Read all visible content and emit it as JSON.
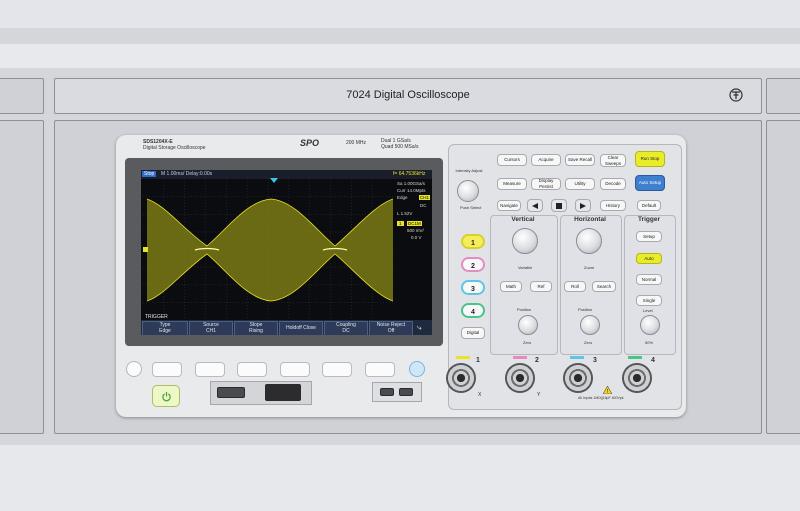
{
  "rack": {
    "title": "7024 Digital Oscilloscope"
  },
  "scope": {
    "model": "SDS1204X-E",
    "model_sub": "Digital Storage Oscilloscope",
    "brand": "SPO",
    "bandwidth": "200 MHz",
    "spec_dual": "Dual   1 GSa/s",
    "spec_quad": "Quad   500 MSa/s"
  },
  "screen": {
    "run_state": "Stop",
    "timebase": "M 1.00ms/  Delay:0.00s",
    "freq": "f= 64.7536kHz",
    "sample_rate": "Sa 1.00GSa/s",
    "memory": "Curr 14.0Mpts",
    "trig_edge": "Edge",
    "trig_ch": "CH1",
    "trig_dc": "DC",
    "trig_level": "L   1.52V",
    "ch1_label": "1",
    "ch1_coupling": "DC1M",
    "ch1_scale": "500 mV/",
    "ch1_offset": "0.0 V",
    "menu_title": "TRIGGER",
    "menu": [
      {
        "top": "Type",
        "bottom": "Edge"
      },
      {
        "top": "Source",
        "bottom": "CH1"
      },
      {
        "top": "Slope",
        "bottom": "Rising"
      },
      {
        "top": "Holdoff Close",
        "bottom": ""
      },
      {
        "top": "Coupling",
        "bottom": "DC"
      },
      {
        "top": "Noise Reject",
        "bottom": "Off"
      }
    ]
  },
  "controls": {
    "intensity": "Intensity Adjust",
    "push_select": "Push Select",
    "cursors": "Cursors",
    "acquire": "Acquire",
    "save_recall": "Save Recall",
    "clear_sweeps": "Clear Sweeps",
    "run_stop": "Run Stop",
    "measure": "Measure",
    "display": "Display Persist",
    "utility": "Utility",
    "decode": "Decode",
    "auto_setup": "Auto Setup",
    "navigate": "Navigate",
    "history": "History",
    "default": "Default",
    "vertical": "Vertical",
    "horizontal": "Horizontal",
    "trigger": "Trigger",
    "variable": "Variable",
    "zoom": "Zoom",
    "math": "Math",
    "ref": "Ref",
    "roll": "Roll",
    "search": "Search",
    "setup": "Setup",
    "auto": "Auto",
    "normal": "Normal",
    "single": "Single",
    "level": "Level",
    "fifty": "50%",
    "position_v": "Position",
    "position_h": "Position",
    "zero_v": "Zero",
    "zero_h": "Zero",
    "digital": "Digital",
    "ch1": "1",
    "ch2": "2",
    "ch3": "3",
    "ch4": "4",
    "input_note": "All Inputs   1MΩ||15pF  400Vpk",
    "x": "X",
    "y": "Y"
  },
  "colors": {
    "ch1": "#e9e32a",
    "ch2": "#e68bc1",
    "ch3": "#5cc6e6",
    "ch4": "#49c58a"
  }
}
